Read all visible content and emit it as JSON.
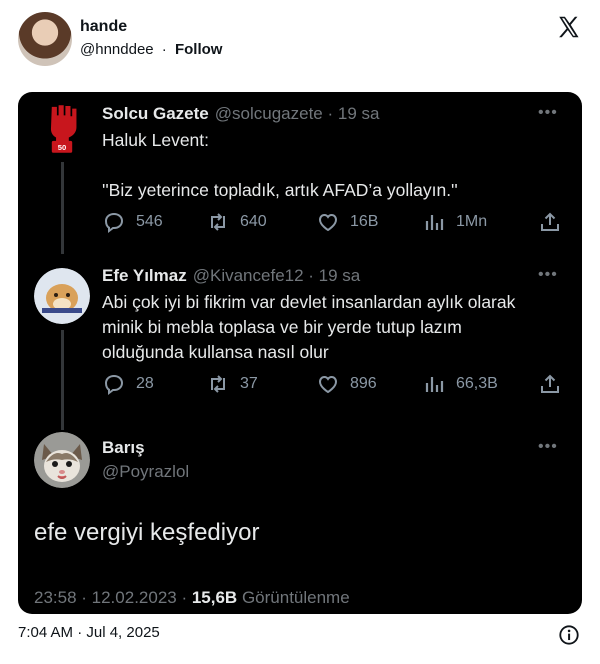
{
  "embed": {
    "author_name": "hande",
    "author_handle": "@hnnddee",
    "separator": "·",
    "follow_label": "Follow",
    "timestamp": "7:04 AM · Jul 4, 2025"
  },
  "screenshot": {
    "tweets": [
      {
        "name": "Solcu Gazete",
        "meta": "@solcugazete · 19 sa",
        "lines": [
          "Haluk Levent:",
          "",
          "''Biz yeterince topladık, artık AFAD’a yollayın.''"
        ],
        "actions": {
          "replies": "546",
          "reposts": "640",
          "likes": "16B",
          "views": "1Mn"
        },
        "avatar_badge": "50"
      },
      {
        "name": "Efe Yılmaz",
        "meta": "@Kivancefe12 · 19 sa",
        "lines": [
          "Abi çok iyi bi fikrim var devlet insanlardan aylık olarak",
          "minik bi mebla toplasa ve bir yerde tutup lazım",
          "olduğunda kullansa nasıl olur"
        ],
        "actions": {
          "replies": "28",
          "reposts": "37",
          "likes": "896",
          "views": "66,3B"
        }
      }
    ],
    "main_tweet": {
      "name": "Barış",
      "handle": "@Poyrazlol",
      "text": "efe vergiyi keşfediyor",
      "time_date": "23:58 · 12.02.2023 · ",
      "views_count": "15,6B",
      "views_label": " Görüntülenme"
    },
    "more_label": "•••"
  },
  "colors": {
    "screenshot_bg": "#000000",
    "text_primary": "#e7e9ea",
    "text_secondary": "#71767b",
    "accent_red": "#c8161d"
  }
}
